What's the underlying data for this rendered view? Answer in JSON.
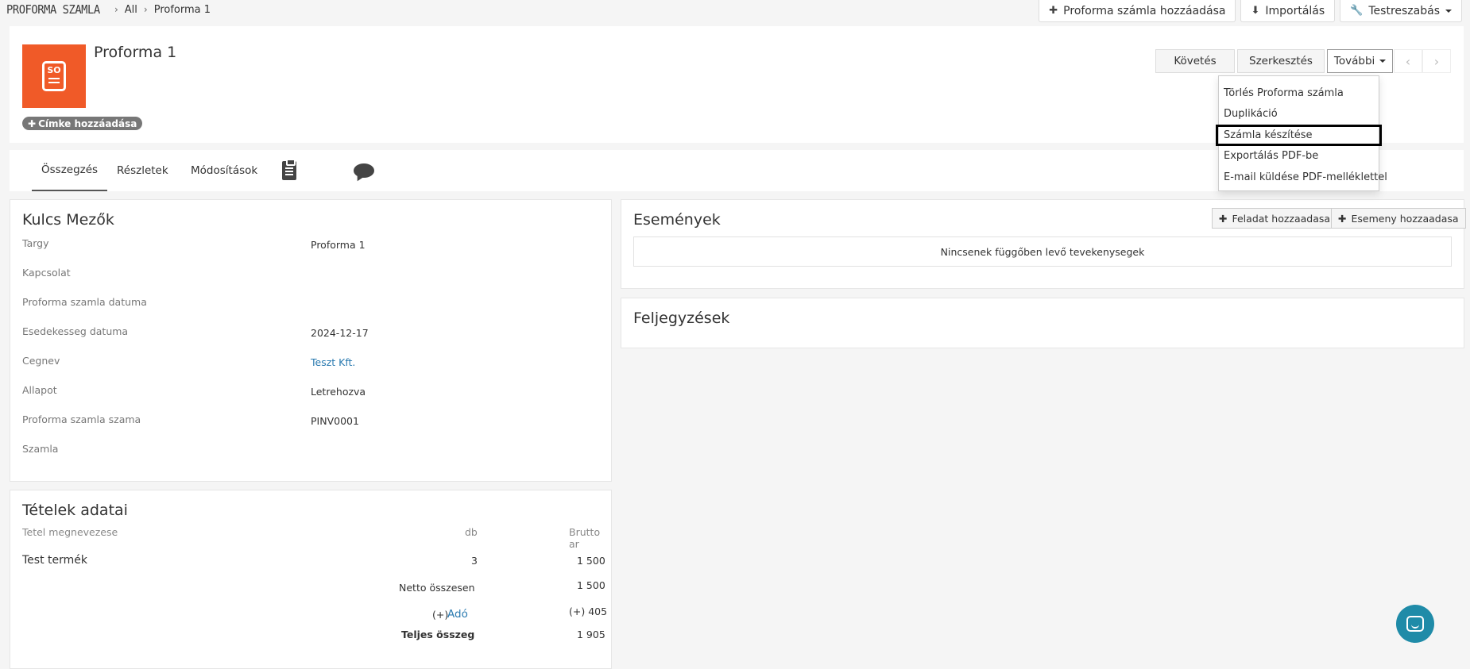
{
  "breadcrumb": {
    "module": "PROFORMA SZAMLA",
    "sep": "›",
    "list": "All",
    "record": "Proforma 1"
  },
  "top_actions": {
    "add": "Proforma számla hozzáadása",
    "import": "Importálás",
    "customize": "Testreszabás"
  },
  "record": {
    "title": "Proforma 1",
    "logo_text": "SO",
    "tag_label": "Címke hozzáadása"
  },
  "header_buttons": {
    "follow": "Követés",
    "edit": "Szerkesztés",
    "more": "További"
  },
  "dropdown": [
    "Törlés Proforma számla",
    "Duplikáció",
    "Számla készítése",
    "Exportálás PDF-be",
    "E-mail küldése PDF-melléklettel"
  ],
  "tabs": {
    "summary": "Összegzés",
    "details": "Részletek",
    "changes": "Módosítások"
  },
  "key_fields": {
    "title": "Kulcs Mezők",
    "rows": [
      {
        "label": "Targy",
        "value": "Proforma 1"
      },
      {
        "label": "Kapcsolat",
        "value": ""
      },
      {
        "label": "Proforma szamla datuma",
        "value": ""
      },
      {
        "label": "Esedekesseg datuma",
        "value": "2024-12-17"
      },
      {
        "label": "Cegnev",
        "value": "Teszt Kft."
      },
      {
        "label": "Allapot",
        "value": "Letrehozva"
      },
      {
        "label": "Proforma szamla szama",
        "value": "PINV0001"
      },
      {
        "label": "Szamla",
        "value": ""
      }
    ]
  },
  "items": {
    "title": "Tételek adatai",
    "col_name": "Tetel megnevezese",
    "col_qty": "db",
    "col_price": "Brutto ar",
    "row_name": "Test termék",
    "row_qty": "3",
    "row_price": "1 500",
    "net_label": "Netto összesen",
    "net_value": "1 500",
    "tax_prefix": "(+)",
    "tax_label": "Adó",
    "tax_value": "(+) 405",
    "total_label": "Teljes összeg",
    "total_value": "1 905"
  },
  "events": {
    "title": "Események",
    "add_task": "Feladat hozzaadasa",
    "add_event": "Esemeny hozzaadasa",
    "empty": "Nincsenek függőben levő tevekenysegek"
  },
  "notes": {
    "title": "Feljegyzések"
  },
  "colors": {
    "brand": "#f05a28",
    "link": "#2a7ab0",
    "fab": "#1f8ba8"
  }
}
